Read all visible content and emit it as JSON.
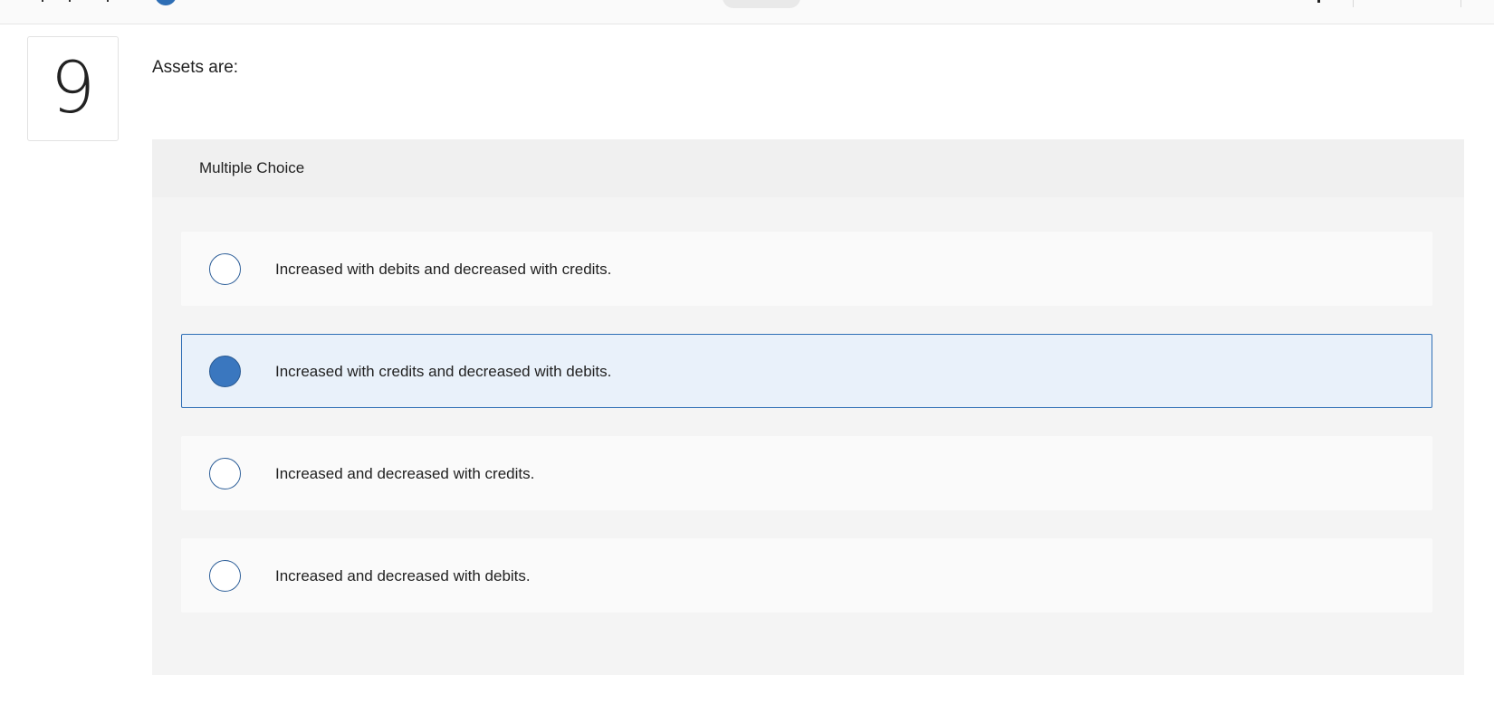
{
  "question": {
    "number": "9",
    "prompt": "Assets are:",
    "type_label": "Multiple Choice"
  },
  "options": [
    {
      "label": "Increased with debits and decreased with credits.",
      "selected": false
    },
    {
      "label": "Increased with credits and decreased with debits.",
      "selected": true
    },
    {
      "label": "Increased and decreased with credits.",
      "selected": false
    },
    {
      "label": "Increased and decreased with debits.",
      "selected": false
    }
  ],
  "colors": {
    "accent": "#2e6eb5",
    "selected_fill": "#3a77bf",
    "selected_background": "#e9f1fa",
    "panel_background": "#f4f4f4",
    "option_background": "#fafafa"
  },
  "icons": {
    "top_info": "info-icon"
  }
}
